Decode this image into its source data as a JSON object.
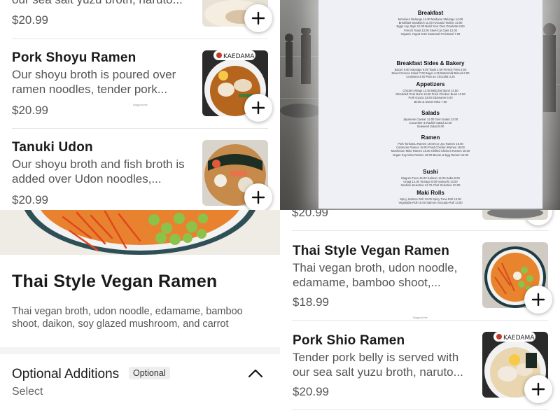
{
  "top_left": {
    "partial_item": {
      "description": "our sea salt yuzu broth, naruto...",
      "price": "$20.99"
    },
    "items": [
      {
        "name": "Pork Shoyu Ramen",
        "description": "Our shoyu broth is poured over ramen noodles, tender pork...",
        "price": "$20.99",
        "image_brand": "KAEDAMA"
      },
      {
        "name": "Tanuki Udon",
        "description": "Our shoyu broth and fish broth is added over Udon noodles,...",
        "price": "$20.99"
      }
    ],
    "footer_tiny": "BaggedUse"
  },
  "top_right": {
    "sections": [
      {
        "title": "Breakfast",
        "lines": [
          "Monsieur Melange 14.00   Madame Melange 14.00",
          "Breakfast Sandwich 11.00   Avocado Tartine 13.00",
          "Eggs Any Style 12.00   Build Your Own Omelette 8.50",
          "French Toast 13.00   Steel-Cut Oats 12.00",
          "Organic Yogurt 9.50   Seasonal Fruit Bowl 7.00"
        ]
      },
      {
        "title": "Breakfast Sides & Bakery",
        "lines": [
          "Bacon 5.50   Sausage 6.00   Toast 2.50   French Fries 5.50",
          "Mixed Greens Salad 7.00   Bagel 4.25   Buttermilk Biscuit 6.00",
          "Croissant 4.00   Pain au Chocolat 4.25"
        ]
      },
      {
        "title": "Appetizers",
        "lines": [
          "Chicken Wings 13.50   BBQ Eel Buns 13.50",
          "Shredded Pork Buns 13.50   Fried Chicken Buns 13.50",
          "Pork Gyoza 13.50   Edamame 6.00",
          "Beets & Sweet Miso 7.00"
        ]
      },
      {
        "title": "Salads",
        "lines": [
          "Japanese Caesar 12.00   Gem Salad 12.00",
          "Cucumber & Radish Salad 12.00",
          "Seaweed Salad 8.00"
        ]
      },
      {
        "title": "Ramen",
        "lines": [
          "Pork Tonkotsu Ramen 19.00   Ice Jyu Ramen 19.00",
          "Carnivore Ramen 19.00   Fried Chicken Ramen 19.00",
          "Mushroom Miso Ramen 18.00   Chilled Chicken Ramen 18.00",
          "Vegan Soy Miso Ramen 18.00   Bacon & Egg Ramen 18.00"
        ]
      },
      {
        "title": "Sushi",
        "lines": [
          "Maguro Tuna 15.00   Salmon 14.00   Saba 8.00",
          "Unagi 12.00   Tamago 8.00   Hamachi 13.00",
          "Sashimi Selection 24.75   Chef Selection 20.00"
        ]
      },
      {
        "title": "Maki Rolls",
        "lines": [
          "Spicy Salmon Roll 13.00   Spicy Tuna Roll 13.00",
          "Vegetable Roll 10.00   Salmon Avocado Roll 13.00"
        ]
      }
    ]
  },
  "bottom_left": {
    "title": "Thai Style Vegan Ramen",
    "description": "Thai vegan broth, udon noodle, edamame, bamboo shoot, daikon, soy glazed mushroom, and carrot",
    "optional": {
      "title": "Optional Additions",
      "badge": "Optional",
      "select_label": "Select"
    }
  },
  "bottom_right": {
    "partial_price": "$20.99",
    "items": [
      {
        "name": "Thai Style Vegan Ramen",
        "description": "Thai vegan broth, udon noodle, edamame, bamboo shoot,...",
        "price": "$18.99"
      },
      {
        "name": "Pork Shio Ramen",
        "description": "Tender pork belly is served with our sea salt yuzu broth, naruto...",
        "price": "$20.99",
        "image_brand": "KAEDAMA"
      }
    ],
    "footer_tiny": "BaggedUse"
  },
  "colors": {
    "accent": "#1f1f1f",
    "muted": "#555555",
    "divider": "#e6e6e6"
  }
}
